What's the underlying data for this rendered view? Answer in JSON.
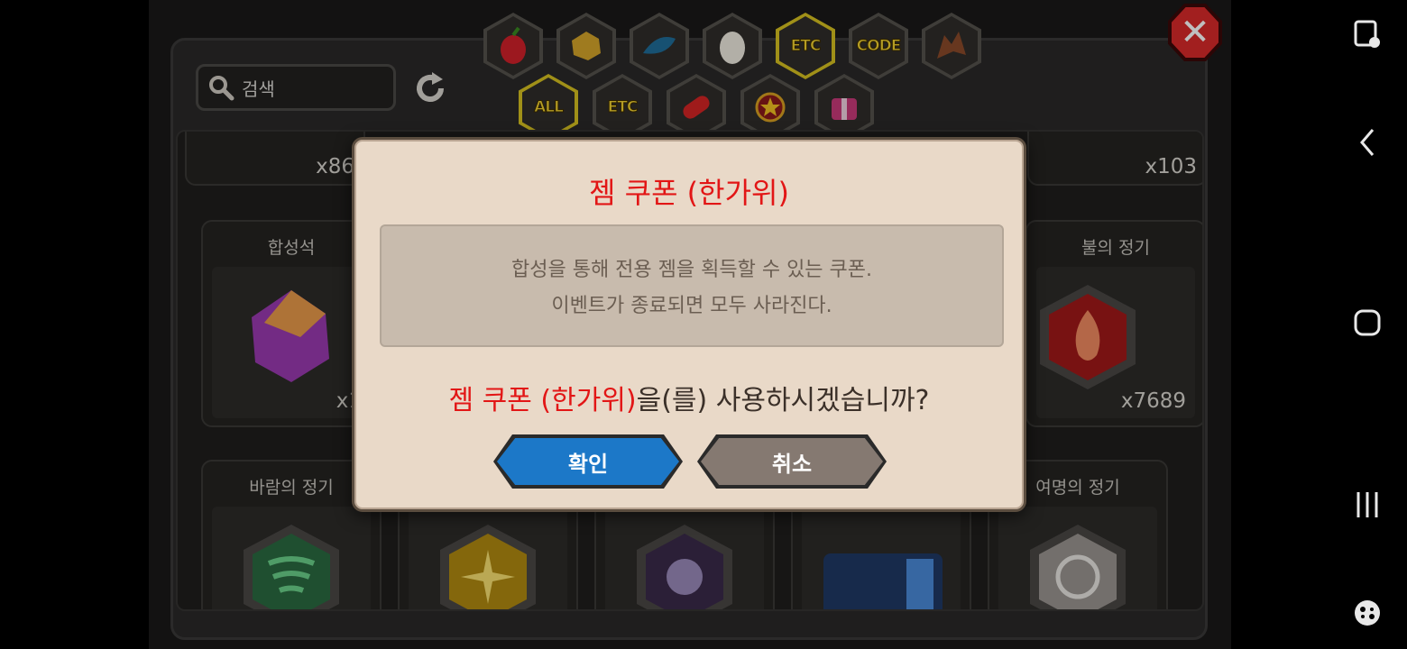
{
  "top_tabs": [
    "fruit-icon",
    "gold-ore-icon",
    "blue-fish-icon",
    "egg-icon",
    "ETC",
    "CODE",
    "dragon-icon"
  ],
  "sub_tabs": [
    "ALL",
    "ETC",
    "capsule-icon",
    "star-medal-icon",
    "gift-box-icon"
  ],
  "search": {
    "placeholder": "검색"
  },
  "items": [
    {
      "name": "",
      "count": "x86"
    },
    {
      "name": "",
      "count": "x103"
    },
    {
      "name": "합성석",
      "count": "x1"
    },
    {
      "name": "불의 정기",
      "count": "x7689"
    },
    {
      "name": "바람의 정기",
      "count": ""
    },
    {
      "name": "여명의 정기",
      "count": ""
    }
  ],
  "dialog": {
    "title": "젬 쿠폰 (한가위)",
    "description_lines": [
      "합성을 통해 전용 젬을 획득할 수 있는 쿠폰.",
      "이벤트가 종료되면 모두 사라진다."
    ],
    "question_item": "젬 쿠폰 (한가위)",
    "question_rest": "을(를) 사용하시겠습니까?",
    "confirm": "확인",
    "cancel": "취소"
  },
  "colors": {
    "dialog_title": "#e21616",
    "confirm_button": "#1c78c8",
    "cancel_button": "#857971",
    "tab_selected_border": "#d6c020"
  }
}
